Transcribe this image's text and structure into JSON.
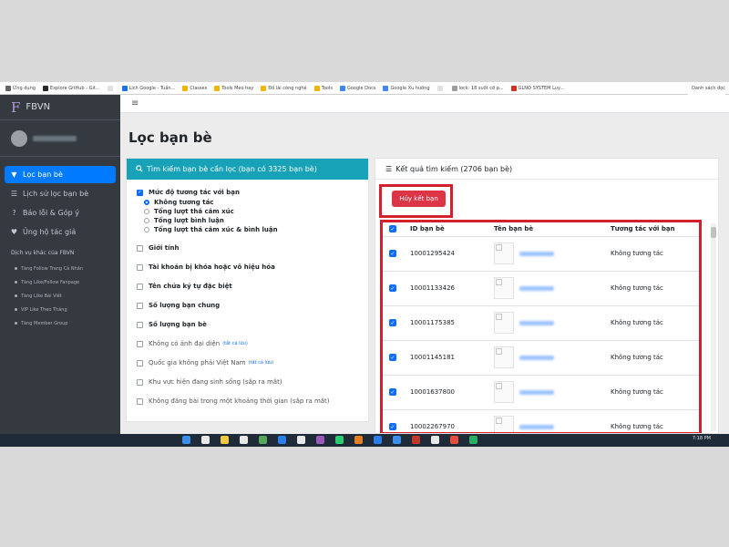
{
  "bookmarks": [
    {
      "label": "Ứng dụng",
      "color": "#5f6368"
    },
    {
      "label": "Explore GitHub - Git...",
      "color": "#24292e"
    },
    {
      "label": "",
      "color": "#e0e0e0"
    },
    {
      "label": "Lịch Google - Tuần...",
      "color": "#1a73e8"
    },
    {
      "label": "Classes",
      "color": "#f4b400"
    },
    {
      "label": "Tools Meo hay",
      "color": "#f4b400"
    },
    {
      "label": "Đồ lài công nghệ",
      "color": "#f4b400"
    },
    {
      "label": "Tools",
      "color": "#f4b400"
    },
    {
      "label": "Google Docs",
      "color": "#4285f4"
    },
    {
      "label": "Google Xu hướng",
      "color": "#4285f4"
    },
    {
      "label": "",
      "color": "#e0e0e0"
    },
    {
      "label": "lock: 18 suốt cỡ p...",
      "color": "#9e9e9e"
    },
    {
      "label": "GLNO SYSTEM Luy...",
      "color": "#d93025"
    }
  ],
  "bookmarks_right": "Danh sách đọc",
  "sidebar": {
    "brand_logo": "F",
    "brand_name": "FBVN",
    "nav": [
      {
        "icon": "▼",
        "label": "Lọc bạn bè",
        "active": true
      },
      {
        "icon": "☰",
        "label": "Lịch sử lọc bạn bè",
        "active": false
      },
      {
        "icon": "?",
        "label": "Báo lỗi & Góp ý",
        "active": false
      },
      {
        "icon": "♥",
        "label": "Ủng hộ tác giả",
        "active": false
      }
    ],
    "section_title": "Dịch vụ khác của FBVN",
    "sub_items": [
      "Tăng Follow Trang Cá Nhân",
      "Tăng Like/Follow Fanpage",
      "Tăng Like Bài Viết",
      "VIP Like Theo Tháng",
      "Tăng Member Group"
    ]
  },
  "topbar": {
    "menu_icon": "≡"
  },
  "page_title": "Lọc bạn bè",
  "filter": {
    "header": "Tìm kiếm bạn bè cần lọc (bạn có 3325 bạn bè)",
    "interaction": {
      "label": "Mức độ tương tác với bạn",
      "checked": true,
      "options": [
        {
          "label": "Không tương tác",
          "selected": true
        },
        {
          "label": "Tổng lượt thả cảm xúc",
          "selected": false
        },
        {
          "label": "Tổng lượt bình luận",
          "selected": false
        },
        {
          "label": "Tổng lượt thả cảm xúc & bình luận",
          "selected": false
        }
      ]
    },
    "items": [
      {
        "label": "Giới tính",
        "badge": "",
        "bold": true
      },
      {
        "label": "Tài khoản bị khóa hoặc vô hiệu hóa",
        "badge": "",
        "bold": true
      },
      {
        "label": "Tên chứa ký tự đặc biệt",
        "badge": "",
        "bold": true
      },
      {
        "label": "Số lượng bạn chung",
        "badge": "",
        "bold": true
      },
      {
        "label": "Số lượng bạn bè",
        "badge": "",
        "bold": true
      },
      {
        "label": "Không có ảnh đại diện",
        "badge": "(tất cả lữu)",
        "bold": false
      },
      {
        "label": "Quốc gia không phải Việt Nam",
        "badge": "(tất cả lữu)",
        "bold": false
      },
      {
        "label": "Khu vực hiện đang sinh sống (sắp ra mắt)",
        "badge": "",
        "bold": false
      },
      {
        "label": "Không đăng bài trong một khoảng thời gian (sắp ra mắt)",
        "badge": "",
        "bold": false
      }
    ]
  },
  "results": {
    "header": "Kết quả tìm kiếm (2706 bạn bè)",
    "unfriend_button": "Hủy kết bạn",
    "columns": [
      "ID bạn bè",
      "Tên bạn bè",
      "Tương tác với bạn"
    ],
    "rows": [
      {
        "id": "10001295424",
        "interaction": "Không tương tác"
      },
      {
        "id": "10001133426",
        "interaction": "Không tương tác"
      },
      {
        "id": "10001175385",
        "interaction": "Không tương tác"
      },
      {
        "id": "10001145181",
        "interaction": "Không tương tác"
      },
      {
        "id": "10001637800",
        "interaction": "Không tương tác"
      },
      {
        "id": "10002267970",
        "interaction": "Không tương tác"
      }
    ]
  },
  "taskbar": {
    "clock": "7:18 PM",
    "icon_colors": [
      "#3b8eea",
      "#e8e8e8",
      "#f2c744",
      "#e8e8e8",
      "#58a55c",
      "#2b7de9",
      "#e8e8e8",
      "#9b59b6",
      "#2ecc71",
      "#e67e22",
      "#2b7de9",
      "#3b8eea",
      "#c0392b",
      "#e8e8e8",
      "#e74c3c",
      "#27ae60"
    ]
  }
}
